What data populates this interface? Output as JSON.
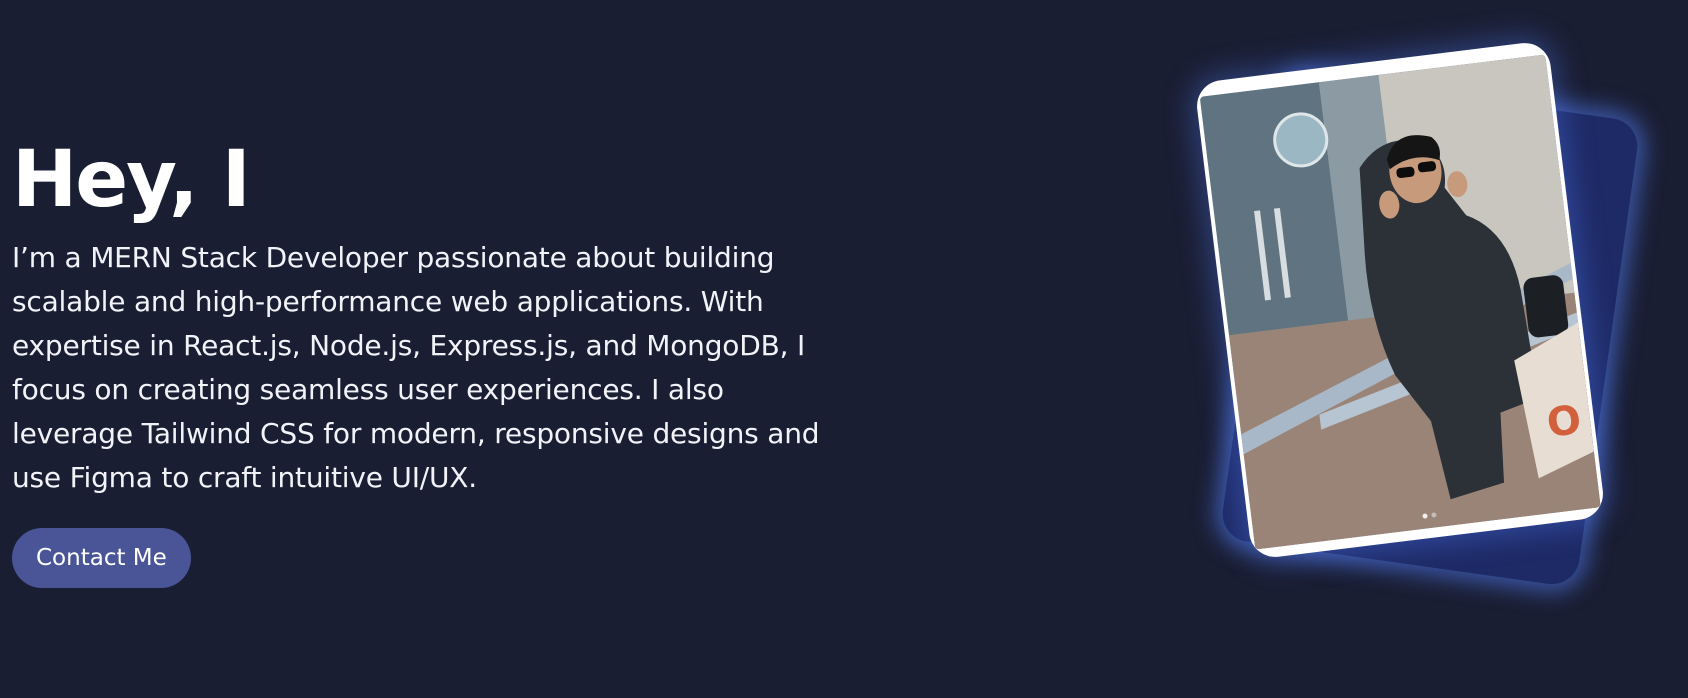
{
  "hero": {
    "title": "Hey, I",
    "bio": "I’m a MERN Stack Developer passionate about building scalable and high-performance web applications. With expertise in React.js, Node.js, Express.js, and MongoDB, I focus on creating seamless user experiences. I also leverage Tailwind CSS for modern, responsive designs and use Figma to craft intuitive UI/UX.",
    "contact_label": "Contact Me"
  },
  "colors": {
    "background": "#1a1e33",
    "button": "#4a5598",
    "back_card": "#1e2a66",
    "glow": "#5682ff"
  }
}
